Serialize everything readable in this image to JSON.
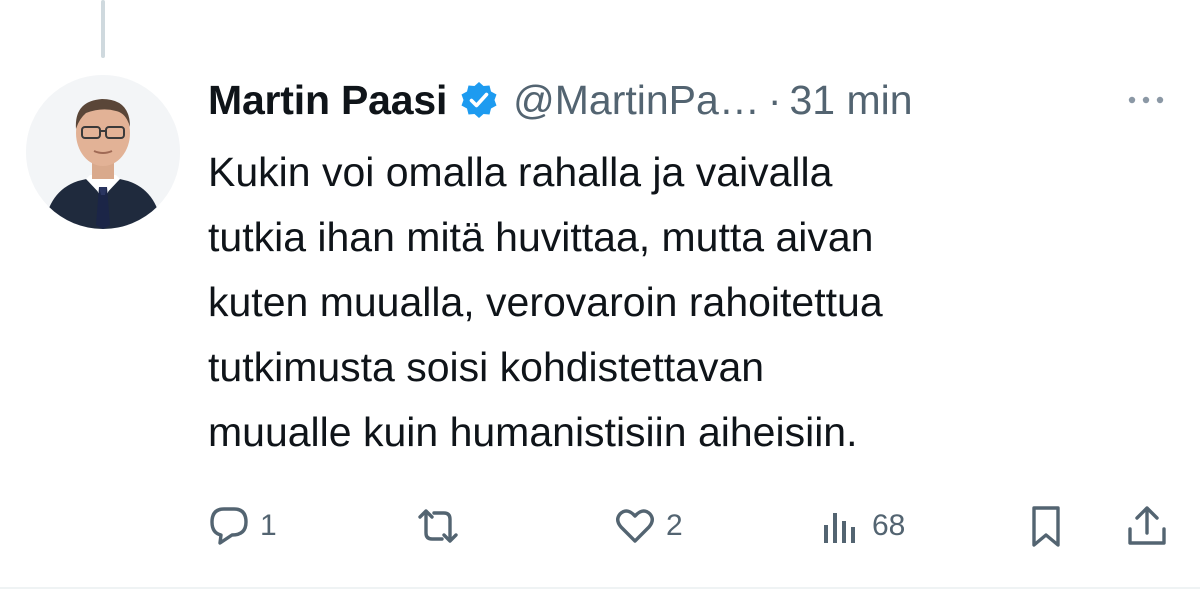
{
  "tweet": {
    "author": {
      "display_name": "Martin Paasi",
      "handle": "@MartinPa…",
      "verified": true,
      "avatar_icon": "person-portrait"
    },
    "separator": "·",
    "time": "31 min",
    "more_icon": "ellipsis-icon",
    "text_lines": [
      "Kukin voi omalla rahalla ja vaivalla",
      "tutkia ihan mitä huvittaa, mutta aivan",
      "kuten muualla, verovaroin rahoitettua",
      "tutkimusta soisi kohdistettavan",
      "muualle kuin humanistisiin aiheisiin."
    ],
    "actions": {
      "reply": {
        "icon": "reply-icon",
        "count": "1"
      },
      "repost": {
        "icon": "repost-icon",
        "count": ""
      },
      "like": {
        "icon": "heart-icon",
        "count": "2"
      },
      "views": {
        "icon": "views-icon",
        "count": "68"
      },
      "bookmark": {
        "icon": "bookmark-icon"
      },
      "share": {
        "icon": "share-icon"
      }
    }
  },
  "colors": {
    "text_primary": "#0f1419",
    "text_secondary": "#536471",
    "verified_badge": "#1d9bf0",
    "thread_line": "#cfd9de",
    "divider": "#eff3f4"
  }
}
